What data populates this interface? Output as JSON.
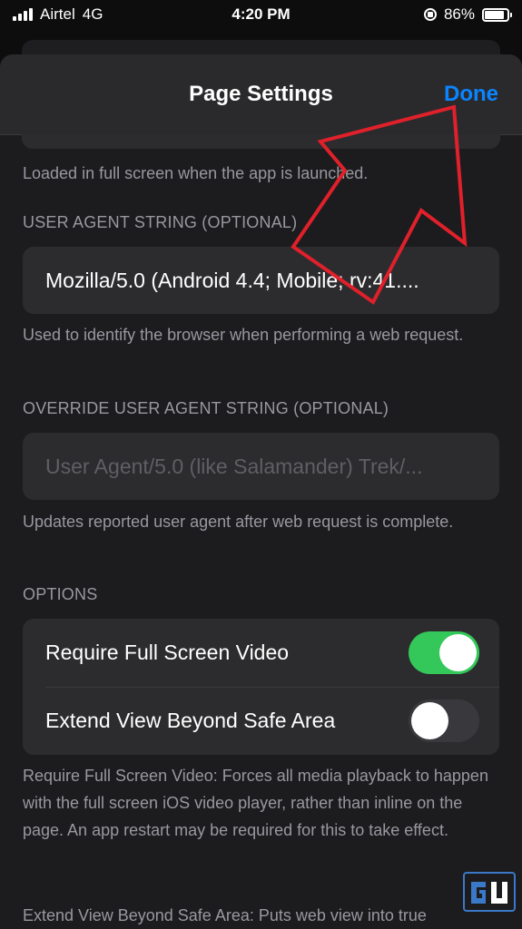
{
  "status_bar": {
    "carrier": "Airtel",
    "network": "4G",
    "time": "4:20 PM",
    "battery": "86%"
  },
  "nav": {
    "title": "Page Settings",
    "done_label": "Done"
  },
  "sections": {
    "fullscreen_footer": "Loaded in full screen when the app is launched.",
    "user_agent": {
      "header": "USER AGENT STRING (OPTIONAL)",
      "value": "Mozilla/5.0 (Android 4.4; Mobile; rv:41....",
      "footer": "Used to identify the browser when performing a web request."
    },
    "override_user_agent": {
      "header": "OVERRIDE USER AGENT STRING (OPTIONAL)",
      "placeholder": "User Agent/5.0 (like Salamander) Trek/...",
      "footer": "Updates reported user agent after web request is complete."
    },
    "options": {
      "header": "OPTIONS",
      "rows": [
        {
          "label": "Require Full Screen Video",
          "on": true
        },
        {
          "label": "Extend View Beyond Safe Area",
          "on": false
        }
      ],
      "footer": "Require Full Screen Video: Forces all media playback to happen with the full screen iOS video player, rather than inline on the page. An app restart may be required for this to take effect.",
      "footer2": "Extend View Beyond Safe Area: Puts web view into true"
    }
  },
  "annotation": {
    "arrow_color": "#e0202a"
  },
  "colors": {
    "accent": "#0a84ff",
    "toggle_on": "#34c759"
  }
}
